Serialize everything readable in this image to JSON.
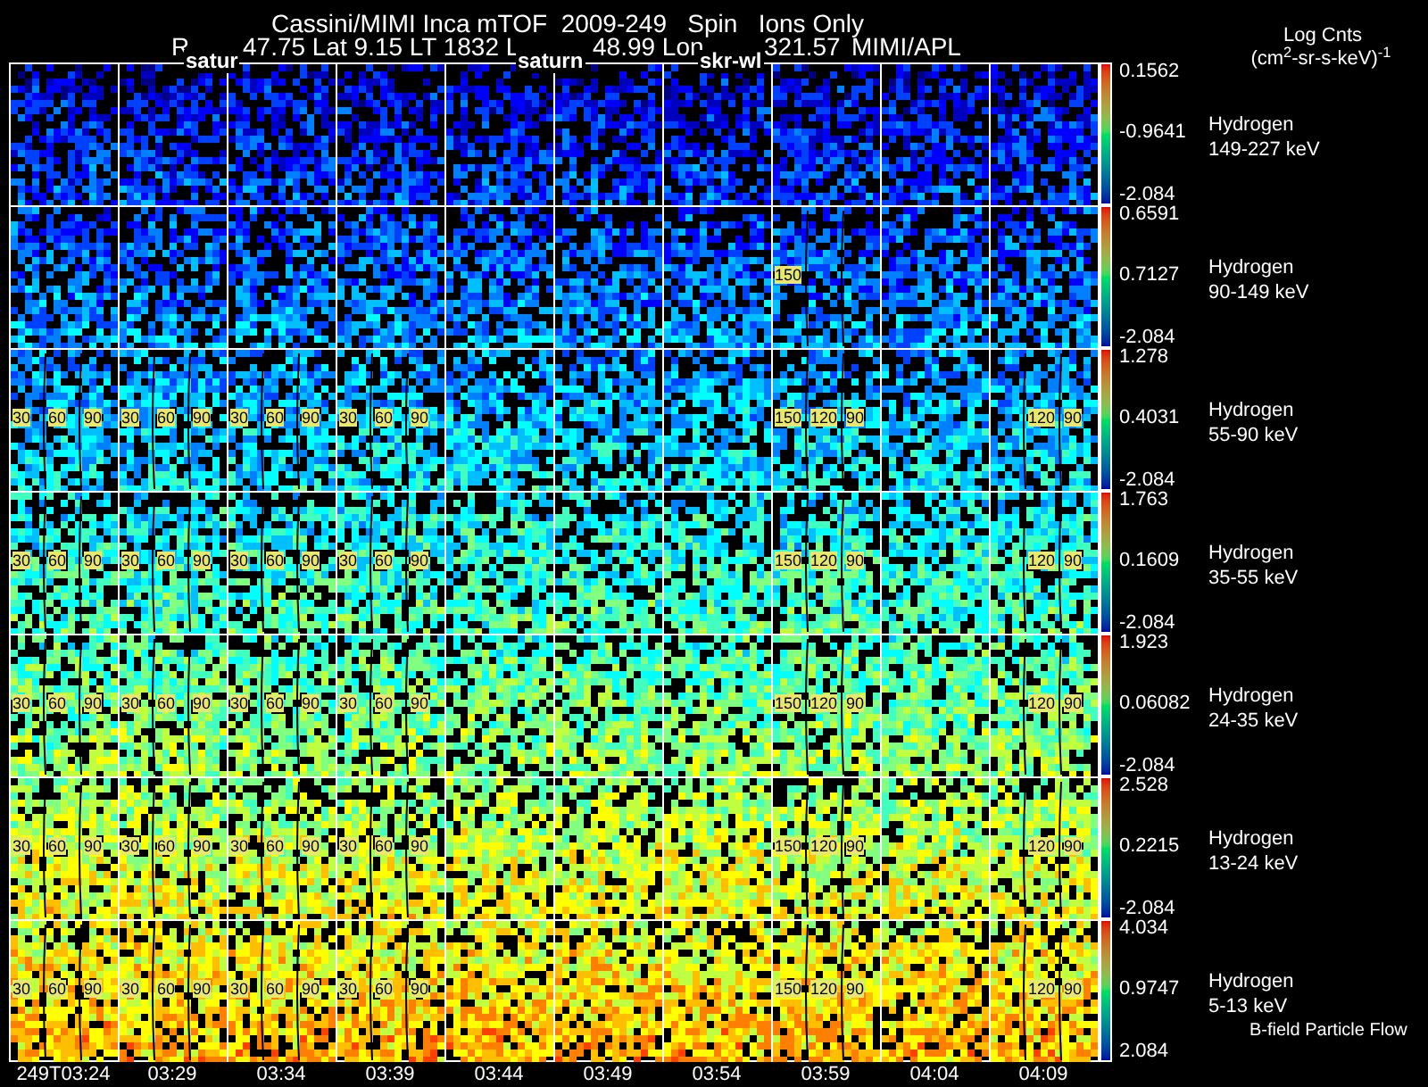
{
  "header": {
    "title": "Cassini/MIMI Inca mTOF  2009-249   Spin   Ions Only",
    "ephemeris": [
      "R",
      "47.75 Lat 9.15 LT 1832 L",
      "48.99 Lon",
      "321.57",
      "MIMI/APL"
    ],
    "overlay_labels": [
      "satur",
      "saturn",
      "skr-wl"
    ]
  },
  "units": {
    "line_1": "Log Cnts",
    "line_2": "(cm$^{2}$-sr-s-keV)$^{-1}$"
  },
  "rows": [
    {
      "species": "Hydrogen",
      "energy": "149-227 keV",
      "scale_max": "0.1562",
      "scale_mid": "-0.9641",
      "scale_min": "-2.084",
      "panels": [
        {
          "kind": "plain"
        },
        {
          "kind": "plain"
        },
        {
          "kind": "plain"
        },
        {
          "kind": "plain"
        },
        {
          "kind": "plain"
        },
        {
          "kind": "plain"
        },
        {
          "kind": "plain"
        },
        {
          "kind": "plain"
        },
        {
          "kind": "plain"
        },
        {
          "kind": "plain"
        }
      ]
    },
    {
      "species": "Hydrogen",
      "energy": "90-149 keV",
      "scale_max": "0.6591",
      "scale_mid": "0.7127",
      "scale_min": "-2.084",
      "panels": [
        {
          "kind": "plain"
        },
        {
          "kind": "plain"
        },
        {
          "kind": "plain"
        },
        {
          "kind": "plain"
        },
        {
          "kind": "plain"
        },
        {
          "kind": "plain"
        },
        {
          "kind": "plain"
        },
        {
          "kind": "contoured",
          "contour_labels": [
            "150"
          ]
        },
        {
          "kind": "plain"
        },
        {
          "kind": "plain"
        }
      ]
    },
    {
      "species": "Hydrogen",
      "energy": "55-90 keV",
      "scale_max": "1.278",
      "scale_mid": "0.4031",
      "scale_min": "-2.084",
      "panels": [
        {
          "kind": "contoured",
          "contour_labels": [
            "30",
            "60",
            "90"
          ]
        },
        {
          "kind": "contoured",
          "contour_labels": [
            "30",
            "60",
            "90"
          ]
        },
        {
          "kind": "contoured",
          "contour_labels": [
            "30",
            "60",
            "90"
          ]
        },
        {
          "kind": "contoured",
          "contour_labels": [
            "30",
            "60",
            "90"
          ]
        },
        {
          "kind": "plain"
        },
        {
          "kind": "plain"
        },
        {
          "kind": "plain"
        },
        {
          "kind": "contoured",
          "contour_labels": [
            "150",
            "120",
            "90"
          ]
        },
        {
          "kind": "plain"
        },
        {
          "kind": "contoured",
          "contour_labels": [
            "120",
            "90"
          ]
        }
      ]
    },
    {
      "species": "Hydrogen",
      "energy": "35-55 keV",
      "scale_max": "1.763",
      "scale_mid": "0.1609",
      "scale_min": "-2.084",
      "panels": [
        {
          "kind": "contoured",
          "contour_labels": [
            "30",
            "60",
            "90"
          ]
        },
        {
          "kind": "contoured",
          "contour_labels": [
            "30",
            "60",
            "90"
          ]
        },
        {
          "kind": "contoured",
          "contour_labels": [
            "30",
            "60",
            "90"
          ]
        },
        {
          "kind": "contoured",
          "contour_labels": [
            "30",
            "60",
            "90"
          ]
        },
        {
          "kind": "plain"
        },
        {
          "kind": "plain"
        },
        {
          "kind": "plain"
        },
        {
          "kind": "contoured",
          "contour_labels": [
            "150",
            "120",
            "90"
          ]
        },
        {
          "kind": "plain"
        },
        {
          "kind": "contoured",
          "contour_labels": [
            "120",
            "90"
          ]
        }
      ]
    },
    {
      "species": "Hydrogen",
      "energy": "24-35 keV",
      "scale_max": "1.923",
      "scale_mid": "0.06082",
      "scale_min": "-2.084",
      "panels": [
        {
          "kind": "contoured",
          "contour_labels": [
            "30",
            "60",
            "90"
          ]
        },
        {
          "kind": "contoured",
          "contour_labels": [
            "30",
            "60",
            "90"
          ]
        },
        {
          "kind": "contoured",
          "contour_labels": [
            "30",
            "60",
            "90"
          ]
        },
        {
          "kind": "contoured",
          "contour_labels": [
            "30",
            "60",
            "90"
          ]
        },
        {
          "kind": "plain"
        },
        {
          "kind": "plain"
        },
        {
          "kind": "plain"
        },
        {
          "kind": "contoured",
          "contour_labels": [
            "150",
            "120",
            "90"
          ]
        },
        {
          "kind": "plain"
        },
        {
          "kind": "contoured",
          "contour_labels": [
            "120",
            "90"
          ]
        }
      ]
    },
    {
      "species": "Hydrogen",
      "energy": "13-24 keV",
      "scale_max": "2.528",
      "scale_mid": "0.2215",
      "scale_min": "-2.084",
      "panels": [
        {
          "kind": "contoured",
          "contour_labels": [
            "30",
            "60",
            "90"
          ]
        },
        {
          "kind": "contoured",
          "contour_labels": [
            "30",
            "60",
            "90"
          ]
        },
        {
          "kind": "contoured",
          "contour_labels": [
            "30",
            "60",
            "90"
          ]
        },
        {
          "kind": "contoured",
          "contour_labels": [
            "30",
            "60",
            "90"
          ]
        },
        {
          "kind": "plain"
        },
        {
          "kind": "plain"
        },
        {
          "kind": "plain"
        },
        {
          "kind": "contoured",
          "contour_labels": [
            "150",
            "120",
            "90"
          ]
        },
        {
          "kind": "plain"
        },
        {
          "kind": "contoured",
          "contour_labels": [
            "120",
            "90"
          ]
        }
      ]
    },
    {
      "species": "Hydrogen",
      "energy": "5-13 keV",
      "scale_max": "4.034",
      "scale_mid": "0.9747",
      "scale_min": "2.084",
      "panels": [
        {
          "kind": "contoured",
          "contour_labels": [
            "30",
            "60",
            "90"
          ]
        },
        {
          "kind": "contoured",
          "contour_labels": [
            "30",
            "60",
            "90"
          ]
        },
        {
          "kind": "contoured",
          "contour_labels": [
            "30",
            "60",
            "90"
          ]
        },
        {
          "kind": "contoured",
          "contour_labels": [
            "30",
            "60",
            "90"
          ]
        },
        {
          "kind": "plain"
        },
        {
          "kind": "plain"
        },
        {
          "kind": "plain"
        },
        {
          "kind": "contoured",
          "contour_labels": [
            "150",
            "120",
            "90"
          ]
        },
        {
          "kind": "plain"
        },
        {
          "kind": "contoured",
          "contour_labels": [
            "120",
            "90"
          ]
        }
      ]
    }
  ],
  "time_labels": [
    "249T03:24",
    "03:29",
    "03:34",
    "03:39",
    "03:44",
    "03:49",
    "03:54",
    "03:59",
    "04:04",
    "04:09"
  ],
  "legend": "B-field Particle Flow"
}
